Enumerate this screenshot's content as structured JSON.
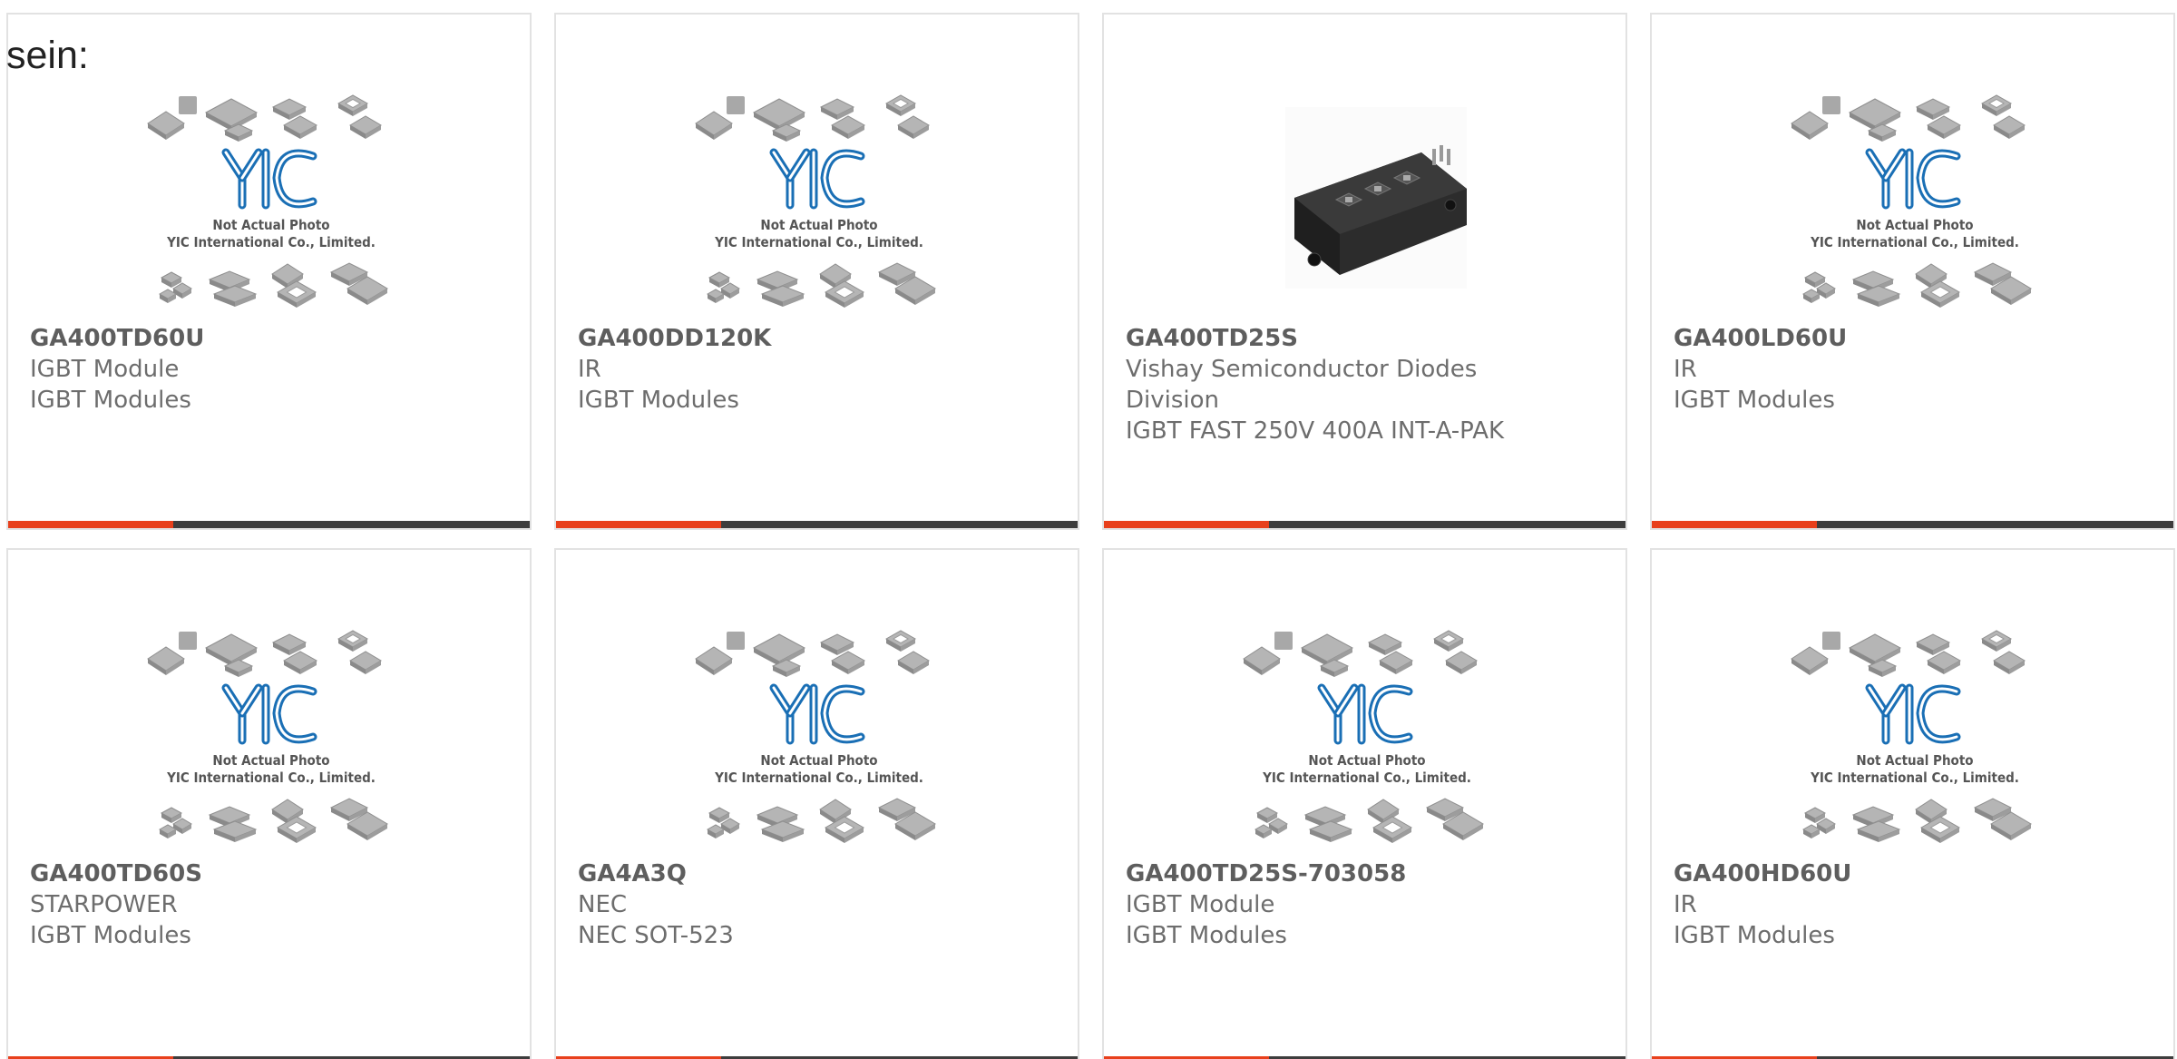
{
  "page": {
    "heading": "sein:"
  },
  "colors": {
    "accent": "#e8401c",
    "bar": "#3d3d3d",
    "logo_blue": "#1a6fb5",
    "chip_gray": "#b5b5b5"
  },
  "placeholder": {
    "caption_line1": "Not Actual Photo",
    "caption_line2": "YIC International Co., Limited.",
    "logo_text": "YIC"
  },
  "products": [
    {
      "part": "GA400TD60U",
      "lines": [
        "IGBT Module",
        "IGBT Modules"
      ],
      "image": "placeholder"
    },
    {
      "part": "GA400DD120K",
      "lines": [
        "IR",
        "IGBT Modules"
      ],
      "image": "placeholder"
    },
    {
      "part": "GA400TD25S",
      "lines": [
        "Vishay Semiconductor Diodes",
        "Division",
        "IGBT FAST 250V 400A INT-A-PAK"
      ],
      "image": "module-photo"
    },
    {
      "part": "GA400LD60U",
      "lines": [
        "IR",
        "IGBT Modules"
      ],
      "image": "placeholder"
    },
    {
      "part": "GA400TD60S",
      "lines": [
        "STARPOWER",
        "IGBT Modules"
      ],
      "image": "placeholder"
    },
    {
      "part": "GA4A3Q",
      "lines": [
        "NEC",
        "NEC SOT-523"
      ],
      "image": "placeholder"
    },
    {
      "part": "GA400TD25S-703058",
      "lines": [
        "IGBT Module",
        "IGBT Modules"
      ],
      "image": "placeholder"
    },
    {
      "part": "GA400HD60U",
      "lines": [
        "IR",
        "IGBT Modules"
      ],
      "image": "placeholder"
    }
  ]
}
